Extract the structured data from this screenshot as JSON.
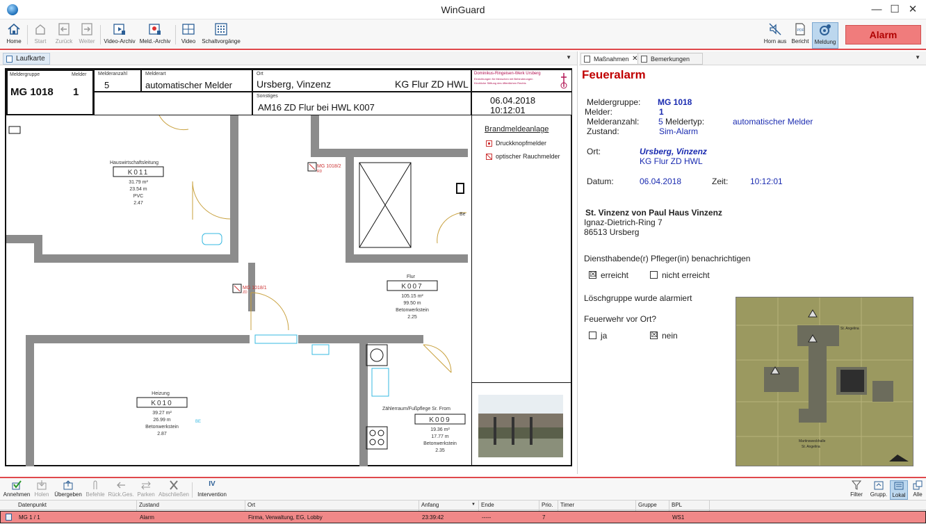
{
  "window": {
    "title": "WinGuard"
  },
  "toolbar": {
    "home": "Home",
    "start": "Start",
    "back": "Zurück",
    "forward": "Weiter",
    "video_archive": "Video-Archiv",
    "meld_archive": "Meld.-Archiv",
    "video": "Video",
    "switching": "Schaltvorgänge",
    "horn_off": "Horn aus",
    "report": "Bericht",
    "report_icon_text": "PDF",
    "message": "Meldung",
    "alarm": "Alarm"
  },
  "left_panel": {
    "tab": "Laufkarte",
    "header": {
      "meldergruppe_label": "Meldergruppe",
      "melder_label": "Melder",
      "meldergruppe": "MG 1018",
      "melder": "1",
      "melderanzahl_label": "Melderanzahl",
      "melderanzahl": "5",
      "melderart_label": "Melderart",
      "melderart": "automatischer Melder",
      "ort_label": "Ort",
      "ort": "Ursberg, Vinzenz",
      "ort2": "KG Flur ZD HWL",
      "sonstiges_label": "Sonstiges",
      "sonstiges": "AM16 ZD Flur bei HWL K007",
      "logo_line1": "Dominikus-Ringeisen-Werk Ursberg",
      "logo_line2": "Einrichtungen für Menschen mit Behinderungen",
      "logo_line3": "Kirchliche Stiftung des öffentlichen Rechts",
      "date": "06.04.2018",
      "time": "10:12:01"
    },
    "legend": {
      "title": "Brandmeldeanlage",
      "items": [
        "Druckknopfmelder",
        "optischer Rauchmelder"
      ]
    },
    "rooms": [
      {
        "name": "Hauswirtschaftsleitung",
        "id": "K011",
        "lines": [
          "31.79 m²",
          "23.54 m",
          "PVC",
          "2.47"
        ]
      },
      {
        "name": "Flur",
        "id": "K007",
        "lines": [
          "105.15 m²",
          "99.50 m",
          "Betonwerkstein",
          "2.25"
        ]
      },
      {
        "name": "Heizung",
        "id": "K010",
        "lines": [
          "39.27 m²",
          "26.99 m",
          "Betonwerkstein",
          "2.87"
        ]
      },
      {
        "name": "Zählerraum/Fußpflege Sr. From",
        "id": "K009",
        "lines": [
          "19.36 m²",
          "17.77 m",
          "Betonwerkstein",
          "2.35"
        ]
      }
    ],
    "detectors": [
      "MG 1018/2",
      "MG 1018/1"
    ],
    "detector_subs": [
      "RD",
      "ZD"
    ],
    "marks": {
      "door_label": "Be",
      "small_label": "BE"
    }
  },
  "right_panel": {
    "tabs": [
      "Maßnahmen",
      "Bemerkungen"
    ],
    "heading": "Feueralarm",
    "labels": {
      "meldergruppe": "Meldergruppe:",
      "melder": "Melder:",
      "melderanzahl": "Melderanzahl:",
      "zustand": "Zustand:",
      "meldertyp": "Meldertyp:",
      "ort": "Ort:",
      "datum": "Datum:",
      "zeit": "Zeit:"
    },
    "values": {
      "meldergruppe": "MG 1018",
      "melder": "1",
      "melderanzahl": "5",
      "meldertyp": "automatischer Melder",
      "zustand": "Sim-Alarm",
      "ort": "Ursberg, Vinzenz",
      "ort2": "KG Flur ZD HWL",
      "datum": "06.04.2018",
      "zeit": "10:12:01"
    },
    "address": {
      "name": "St. Vinzenz von Paul Haus Vinzenz",
      "street": "Ignaz-Dietrich-Ring 7",
      "city": "86513 Ursberg"
    },
    "question1": "Diensthabende(r) Pfleger(in) benachrichtigen",
    "q1_options": [
      {
        "label": "erreicht",
        "checked": true
      },
      {
        "label": "nicht erreicht",
        "checked": false
      }
    ],
    "statement": "Löschgruppe wurde alarmiert",
    "question2": "Feuerwehr vor Ort?",
    "q2_options": [
      {
        "label": "ja",
        "checked": false
      },
      {
        "label": "nein",
        "checked": true
      }
    ],
    "check_mark": "☒",
    "map": {
      "label1": "St. Angelina",
      "label2": "Martinsweckhalle",
      "label3": "St. Angelina"
    }
  },
  "actions": [
    "Annehmen",
    "Holen",
    "Übergeben",
    "Befehle",
    "Rück.Ges.",
    "Parken",
    "Abschließen",
    "Intervention"
  ],
  "actions_disabled": [
    false,
    true,
    false,
    true,
    true,
    true,
    true,
    false
  ],
  "intervention_icon_text": "IV",
  "view_actions": [
    "Filter",
    "Grupp.",
    "Lokal",
    "Alle"
  ],
  "table": {
    "columns": [
      "Datenpunkt",
      "Zustand",
      "Ort",
      "Anfang",
      "Ende",
      "Prio.",
      "Timer",
      "Gruppe",
      "BPL"
    ],
    "rows": [
      {
        "datenpunkt": "MG 1 / 1",
        "zustand": "Alarm",
        "ort": "Firma, Verwaltung, EG, Lobby",
        "anfang": "23:39:42",
        "ende": "-----",
        "prio": "7",
        "timer": "",
        "gruppe": "",
        "bpl": "WS1"
      }
    ]
  },
  "colors": {
    "accent_red": "#e0484c",
    "alarm_row": "#f08888",
    "value_blue": "#1a2bb0",
    "heading_red": "#c00000"
  }
}
